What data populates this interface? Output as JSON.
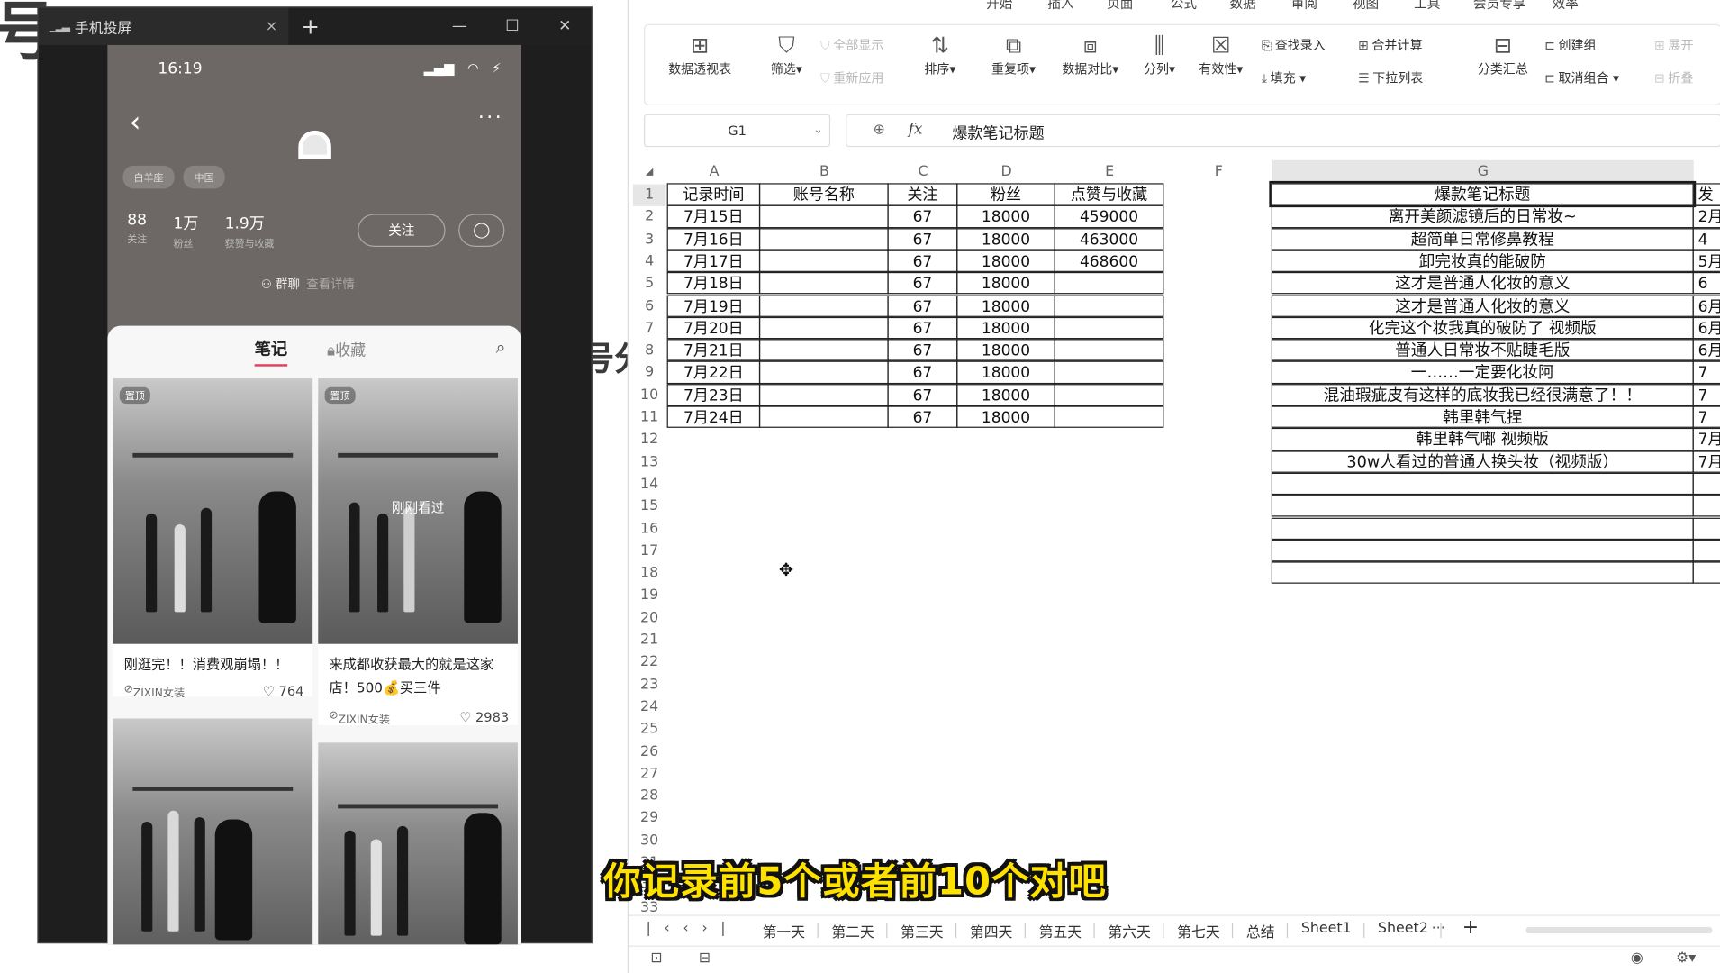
{
  "mirror_window": {
    "title": "手机投屏",
    "close_tab": "×",
    "new_tab": "+",
    "minimize": "—",
    "maximize": "☐",
    "close": "✕"
  },
  "phone": {
    "time": "16:19",
    "tags": [
      "白羊座",
      "中国"
    ],
    "stats": [
      {
        "num": "88",
        "label": "关注"
      },
      {
        "num": "1万",
        "label": "粉丝"
      },
      {
        "num": "1.9万",
        "label": "获赞与收藏"
      }
    ],
    "follow_label": "关注",
    "group_label": "群聊",
    "group_extra": "查看详情",
    "tab_notes": "笔记",
    "tab_fav": "收藏",
    "cards": [
      {
        "badge": "置顶",
        "overlay": "",
        "title": "刚逛完！！消费观崩塌！！",
        "author": "ZIXIN女装",
        "likes": "764"
      },
      {
        "badge": "置顶",
        "overlay": "刚刚看过",
        "title": "来成都收获最大的就是这家店！500💰买三件",
        "author": "ZIXIN女装",
        "likes": "2983"
      },
      {
        "badge": "",
        "overlay": "",
        "title": "",
        "author": "",
        "likes": ""
      },
      {
        "badge": "",
        "overlay": "",
        "title": "",
        "author": "",
        "likes": ""
      }
    ]
  },
  "spreadsheet": {
    "menu": [
      "开始",
      "插入",
      "页面",
      "公式",
      "数据",
      "审阅",
      "视图",
      "工具",
      "会员专享",
      "效率"
    ],
    "active_menu": "数据",
    "ribbon": {
      "pivot": "数据透视表",
      "filter": "筛选",
      "show_all": "全部显示",
      "reapply": "重新应用",
      "sort": "排序",
      "duplicates": "重复项",
      "compare": "数据对比",
      "split": "分列",
      "validity": "有效性",
      "lookup": "查找录入",
      "fill": "填充",
      "consolidate": "合并计算",
      "dropdown": "下拉列表",
      "subtotal": "分类汇总",
      "group": "创建组",
      "ungroup": "取消组合",
      "expand": "展开",
      "collapse": "折叠"
    },
    "name_box": "G1",
    "formula": "爆款笔记标题",
    "columns": [
      "A",
      "B",
      "C",
      "D",
      "E",
      "F",
      "G"
    ],
    "headers": [
      "记录时间",
      "账号名称",
      "关注",
      "粉丝",
      "点赞与收藏"
    ],
    "rows": [
      [
        "7月15日",
        "",
        "67",
        "18000",
        "459000"
      ],
      [
        "7月16日",
        "",
        "67",
        "18000",
        "463000"
      ],
      [
        "7月17日",
        "",
        "67",
        "18000",
        "468600"
      ],
      [
        "7月18日",
        "",
        "67",
        "18000",
        ""
      ],
      [
        "7月19日",
        "",
        "67",
        "18000",
        ""
      ],
      [
        "7月20日",
        "",
        "67",
        "18000",
        ""
      ],
      [
        "7月21日",
        "",
        "67",
        "18000",
        ""
      ],
      [
        "7月22日",
        "",
        "67",
        "18000",
        ""
      ],
      [
        "7月23日",
        "",
        "67",
        "18000",
        ""
      ],
      [
        "7月24日",
        "",
        "67",
        "18000",
        ""
      ]
    ],
    "g_header": "爆款笔记标题",
    "g_values": [
      "离开美颜滤镜后的日常妆~",
      "超简单日常修鼻教程",
      "卸完妆真的能破防",
      "这才是普通人化妆的意义",
      "这才是普通人化妆的意义",
      "化完这个妆我真的破防了 视频版",
      "普通人日常妆不贴睫毛版",
      "一……一定要化妆阿",
      "混油瑕疵皮有这样的底妆我已经很满意了！！",
      "韩里韩气捏",
      "韩里韩气嘟 视频版",
      "30w人看过的普通人换头妆（视频版）"
    ],
    "h_partial": [
      "发",
      "2月",
      "4",
      "5月",
      "6",
      "6月",
      "6月",
      "6月",
      "7",
      "7",
      "7",
      "7月",
      "7月"
    ],
    "row_numbers": [
      "1",
      "2",
      "3",
      "4",
      "5",
      "6",
      "7",
      "8",
      "9",
      "10",
      "11",
      "12",
      "13",
      "14",
      "15",
      "16",
      "17",
      "18",
      "19",
      "20",
      "21",
      "22",
      "23",
      "24",
      "25",
      "26",
      "27",
      "28",
      "29",
      "30",
      "31",
      "32",
      "33"
    ],
    "sheet_tabs": [
      "第一天",
      "第二天",
      "第三天",
      "第四天",
      "第五天",
      "第六天",
      "第七天",
      "总结",
      "Sheet1",
      "Sheet2"
    ]
  },
  "background_fragments": [
    "号",
    "号",
    "号分"
  ],
  "subtitle": "你记录前5个或者前10个对吧"
}
